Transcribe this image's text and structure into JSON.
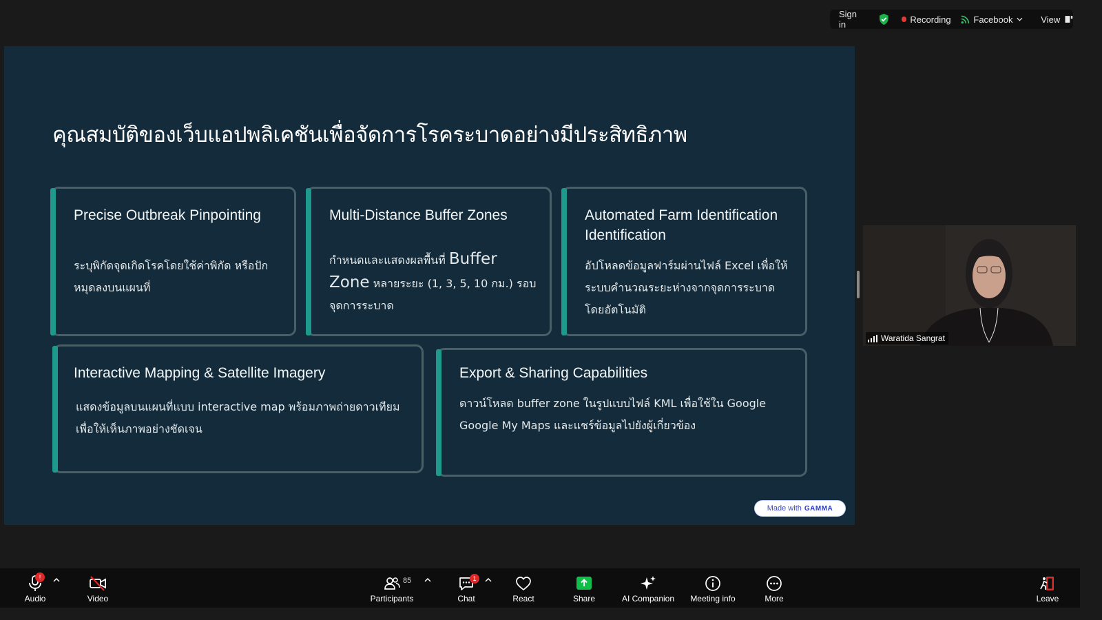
{
  "topbar": {
    "sign_in": "Sign in",
    "recording": "Recording",
    "facebook": "Facebook",
    "view": "View"
  },
  "slide": {
    "title": "คุณสมบัติของเว็บแอปพลิเคชันเพื่อจัดการโรคระบาดอย่างมีประสิทธิภาพ",
    "cards": [
      {
        "title": "Precise Outbreak Pinpointing",
        "body": "ระบุพิกัดจุดเกิดโรคโดยใช้ค่าพิกัด หรือปักหมุดลงบนแผนที่"
      },
      {
        "title": "Multi-Distance Buffer Zones",
        "body_a": "กำหนดและแสดงผลพื้นที่ ",
        "body_big": "Buffer Zone",
        "body_b": " หลายระยะ (1, 3, 5, 10 กม.) รอบจุดการระบาด"
      },
      {
        "title": "Automated Farm Identification Identification",
        "body": "อัปโหลดข้อมูลฟาร์มผ่านไฟล์ Excel เพื่อให้ระบบคำนวณระยะห่างจากจุดการระบาดโดยอัตโนมัติ"
      },
      {
        "title": "Interactive Mapping & Satellite Imagery",
        "body": "แสดงข้อมูลบนแผนที่แบบ interactive map พร้อมภาพถ่ายดาวเทียม เพื่อให้เห็นภาพอย่างชัดเจน"
      },
      {
        "title": "Export & Sharing Capabilities",
        "body": "ดาวน์โหลด buffer zone ในรูปแบบไฟล์ KML เพื่อใช้ใน Google Google My Maps และแชร์ข้อมูลไปยังผู้เกี่ยวข้อง"
      }
    ],
    "badge_prefix": "Made with",
    "badge_brand": "GAMMA"
  },
  "participant_video": {
    "name": "Waratida Sangrat"
  },
  "toolbar": {
    "audio": "Audio",
    "audio_badge": "!",
    "video": "Video",
    "participants": "Participants",
    "participants_count": "85",
    "chat": "Chat",
    "chat_badge": "1",
    "react": "React",
    "share": "Share",
    "ai_companion": "AI Companion",
    "meeting_info": "Meeting info",
    "more": "More",
    "leave": "Leave"
  },
  "colors": {
    "slide_bg": "#132b3a",
    "card_accent": "#1d9a8b",
    "share_green": "#0fbf4a",
    "recording_red": "#e53935"
  }
}
